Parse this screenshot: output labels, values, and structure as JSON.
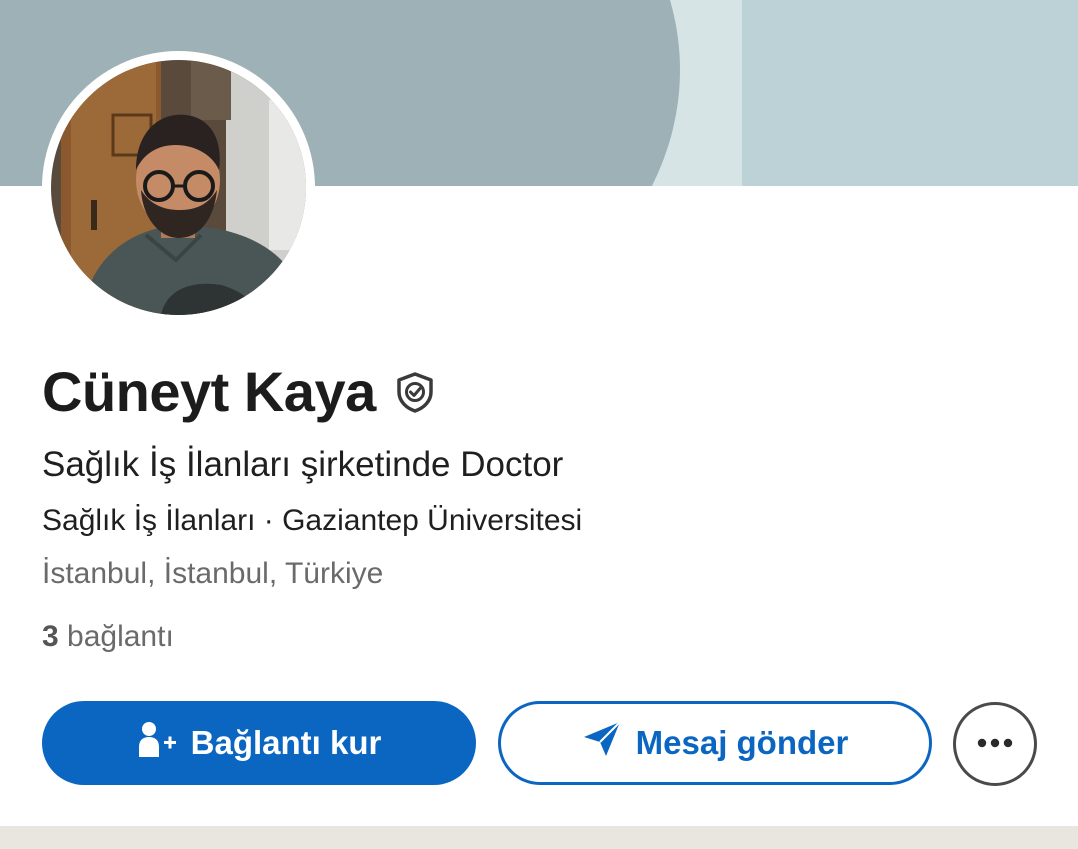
{
  "profile": {
    "name": "Cüneyt Kaya",
    "headline": "Sağlık İş İlanları şirketinde Doctor",
    "orgs": "Sağlık İş İlanları · Gaziantep Üniversitesi",
    "location": "İstanbul, İstanbul, Türkiye",
    "connections_count": "3",
    "connections_label": "bağlantı",
    "verified_icon": "shield-check-icon"
  },
  "actions": {
    "connect_label": "Bağlantı kur",
    "connect_icon": "add-person-icon",
    "message_label": "Mesaj gönder",
    "message_icon": "send-icon",
    "more_icon": "more-horizontal-icon"
  },
  "colors": {
    "accent": "#0b66c2",
    "banner_dark": "#9db1b6",
    "banner_light": "#bcd2d6",
    "text_primary": "#1c1c1c",
    "text_secondary": "#6a6a6a"
  }
}
